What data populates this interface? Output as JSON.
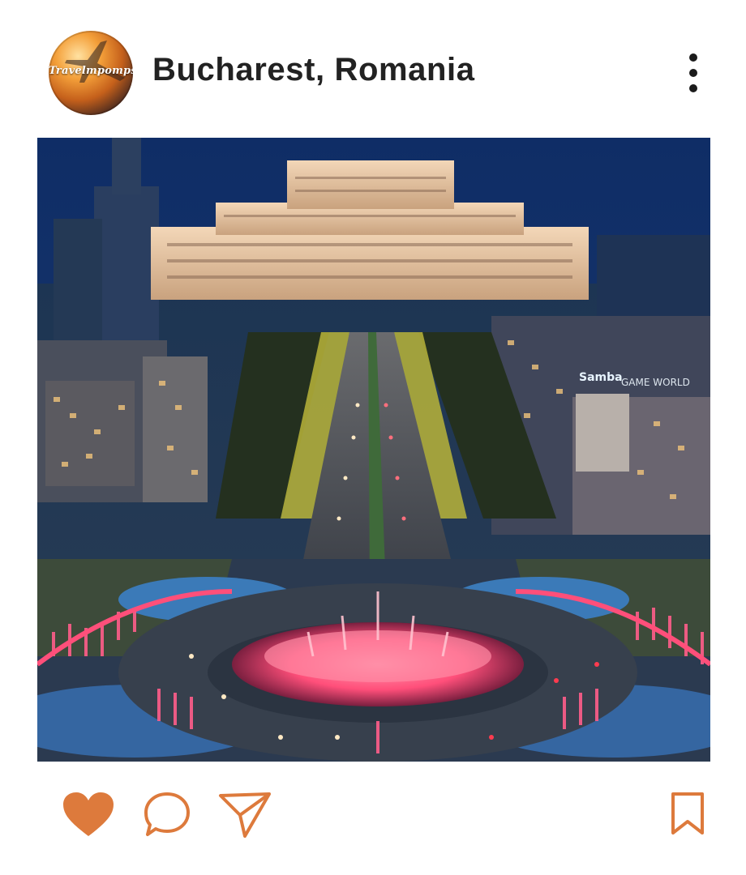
{
  "post": {
    "avatar_logo_text": "Travelmpomps",
    "location": "Bucharest, Romania",
    "photo_signs": [
      "Samba",
      "GAME WORLD"
    ]
  },
  "icons": {
    "avatar": "profile-avatar-icon",
    "more": "more-options-icon",
    "like": "heart-icon",
    "comment": "comment-icon",
    "share": "send-icon",
    "save": "bookmark-icon"
  },
  "colors": {
    "accent": "#dd7a3c",
    "title": "#222222",
    "background": "#ffffff"
  }
}
